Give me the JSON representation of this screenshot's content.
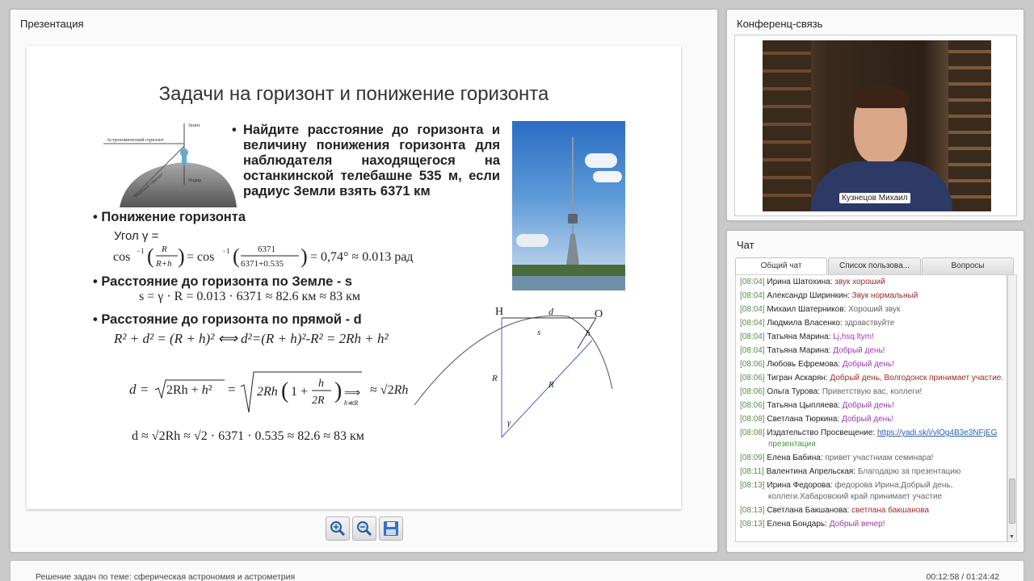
{
  "presentation": {
    "title": "Презентация",
    "slide": {
      "heading": "Задачи на горизонт и понижение горизонта",
      "diagram_labels": {
        "zenith": "Зенит",
        "horizon": "Астрономический горизонт",
        "visible_horizon": "Видимый горизонт",
        "nadir": "Надир"
      },
      "bullets": [
        "Найдите расстояние до горизонта и величину понижения горизонта для наблюдателя находящегося на останкинской телебашне 535 м, если радиус Земли взять 6371 км",
        "Понижение горизонта",
        "Расстояние до горизонта по Земле - s",
        "Расстояние до горизонта по прямой - d"
      ],
      "angle_label": "Угол γ =",
      "formula_gamma": "= 0,74° ≈ 0.013 рад",
      "formula_s": "s = γ · R = 0.013 · 6371 ≈ 82.6 км  ≈ 83 км",
      "formula_pyth": "R² + d² = (R + h)² ⟺ d²=(R + h)²-R² = 2Rh + h²",
      "formula_d_final": "d ≈ √2Rh ≈ √2 · 6371 · 0.535 ≈ 82.6 ≈ 83 км",
      "geometry_labels": {
        "H": "H",
        "O": "O",
        "d": "d",
        "s": "s",
        "h": "h",
        "R1": "R",
        "R2": "R",
        "gamma": "γ"
      }
    },
    "toolbar": {
      "zoom_in": "zoom-in-icon",
      "zoom_out": "zoom-out-icon",
      "save": "save-icon"
    }
  },
  "conference": {
    "title": "Конференц-связь",
    "speaker_name": "Кузнецов Михаил"
  },
  "chat": {
    "title": "Чат",
    "tabs": [
      "Общий чат",
      "Список пользова...",
      "Вопросы"
    ],
    "messages": [
      {
        "time": "[08:04]",
        "name": "Ирина Шатохина:",
        "text": "звук хороший",
        "color": "#a02828"
      },
      {
        "time": "[08:04]",
        "name": "Александр Ширинкин:",
        "text": "Звук нормальный",
        "color": "#a02828"
      },
      {
        "time": "[08:04]",
        "name": "Михаил Шатерников:",
        "text": "Хороший звук",
        "color": "#666666"
      },
      {
        "time": "[08:04]",
        "name": "Людмила Власенко:",
        "text": "здравствуйте",
        "color": "#666666"
      },
      {
        "time": "[08:04]",
        "name": "Татьяна Марина:",
        "text": "Lj,hsq ltym!",
        "color": "#9a3ab0"
      },
      {
        "time": "[08:04]",
        "name": "Татьяна Марина:",
        "text": "Добрый день!",
        "color": "#9a3ab0"
      },
      {
        "time": "[08:06]",
        "name": "Любовь Ефремова:",
        "text": "Добрый день!",
        "color": "#9a3ab0"
      },
      {
        "time": "[08:06]",
        "name": "Тигран Аскарян:",
        "text": "Добрый день, Волгодонск принимает участие.",
        "color": "#a02828"
      },
      {
        "time": "[08:06]",
        "name": "Ольга Турова:",
        "text": "Приветствую вас, коллеги!",
        "color": "#666666"
      },
      {
        "time": "[08:06]",
        "name": "Татьяна Цыпляева:",
        "text": "Добрый день!",
        "color": "#9a3ab0"
      },
      {
        "time": "[08:08]",
        "name": "Светлана Тюркина:",
        "text": "Добрый день!",
        "color": "#9a3ab0"
      },
      {
        "time": "[08:08]",
        "name": "Издательство Просвещение:",
        "text": "",
        "link": "https://yadi.sk/i/vlOg4B3e3NFjEG",
        "extra": "презентация",
        "color": "#3a9a3a"
      },
      {
        "time": "[08:09]",
        "name": "Елена Бабина:",
        "text": "привет участниам семинара!",
        "color": "#666666"
      },
      {
        "time": "[08:11]",
        "name": "Валентина Апрельская:",
        "text": "Благодарю за презентацию",
        "color": "#666666"
      },
      {
        "time": "[08:13]",
        "name": "Ирина Федорова:",
        "text": "федорова Ирина:Добрый день, коллеги.Хабаровский край принимает участие",
        "color": "#666666"
      },
      {
        "time": "[08:13]",
        "name": "Светлана Бакшанова:",
        "text": "светлана бакшанова",
        "color": "#a02828"
      },
      {
        "time": "[08:13]",
        "name": "Елена Бондарь:",
        "text": "Добрый вечер!",
        "color": "#9a3ab0"
      }
    ]
  },
  "footer": {
    "topic": "Решение задач по теме: сферическая астрономия и астрометрия",
    "time": "00:12:58 / 01:24:42"
  }
}
